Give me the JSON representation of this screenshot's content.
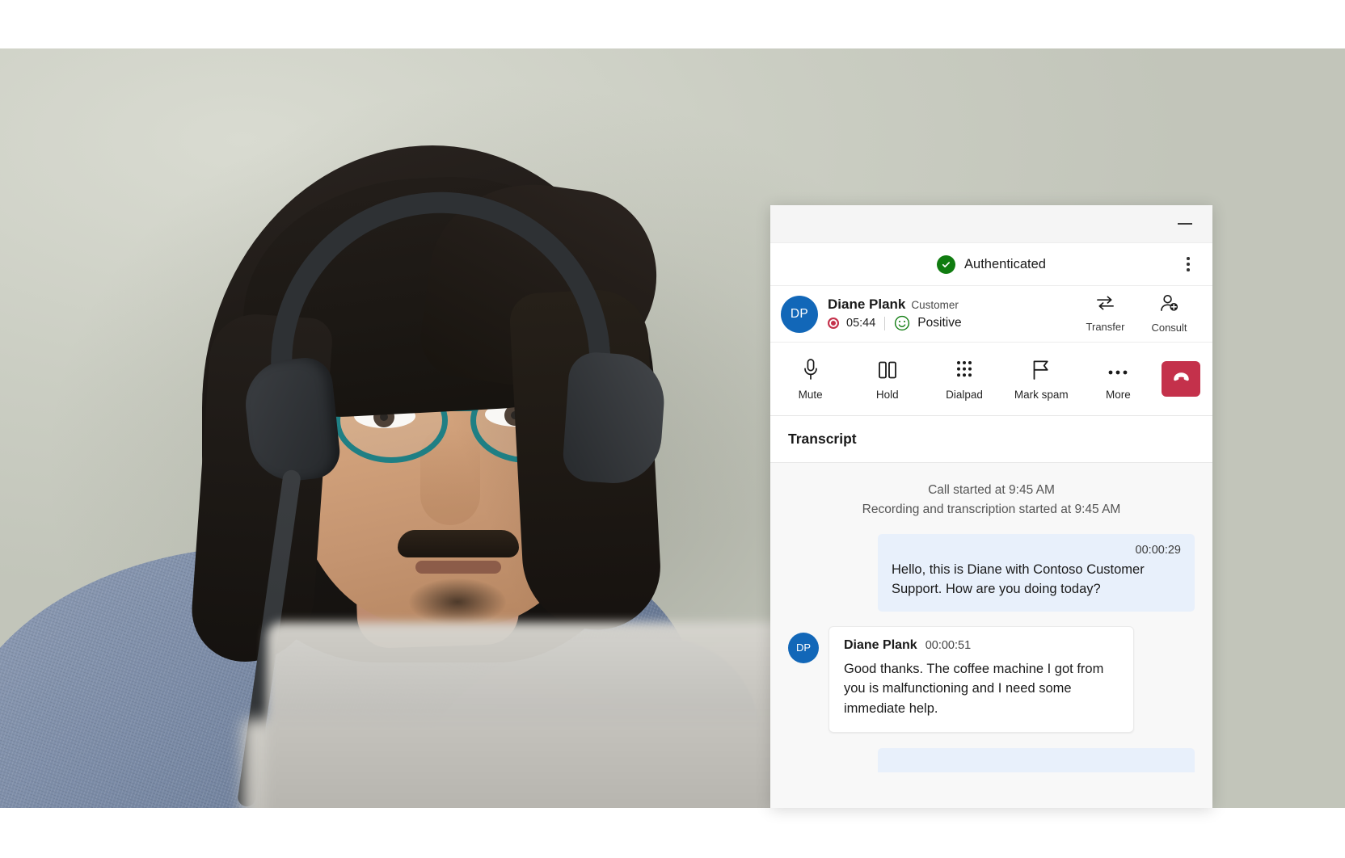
{
  "window": {
    "minimize_label": "Minimize"
  },
  "auth": {
    "status_label": "Authenticated",
    "check_icon": "check-circle-icon",
    "more_menu_icon": "kebab-menu-icon",
    "accent_green": "#107c10"
  },
  "contact": {
    "avatar_initials": "DP",
    "avatar_color": "#1267b8",
    "name": "Diane Plank",
    "role": "Customer",
    "call_timer": "05:44",
    "recording_color": "#c4314b",
    "sentiment": "Positive",
    "sentiment_color": "#107c10",
    "actions": [
      {
        "label": "Transfer",
        "icon": "transfer-arrows-icon"
      },
      {
        "label": "Consult",
        "icon": "person-add-icon"
      }
    ]
  },
  "call_controls": [
    {
      "label": "Mute",
      "icon": "microphone-icon"
    },
    {
      "label": "Hold",
      "icon": "pause-icon"
    },
    {
      "label": "Dialpad",
      "icon": "dialpad-icon"
    },
    {
      "label": "Mark spam",
      "icon": "flag-icon"
    },
    {
      "label": "More",
      "icon": "ellipsis-icon"
    }
  ],
  "end_call": {
    "icon": "phone-hangup-icon",
    "color": "#c4314b"
  },
  "transcript": {
    "title": "Transcript",
    "system_lines": [
      "Call started at 9:45 AM",
      "Recording and transcription started at 9:45 AM"
    ],
    "messages": [
      {
        "side": "agent",
        "time": "00:00:29",
        "text": "Hello, this is Diane with Contoso Customer Support. How are you doing today?"
      },
      {
        "side": "customer",
        "avatar_initials": "DP",
        "name": "Diane Plank",
        "time": "00:00:51",
        "text": "Good thanks. The coffee machine I got from you is malfunctioning and I need some immediate help."
      }
    ]
  }
}
